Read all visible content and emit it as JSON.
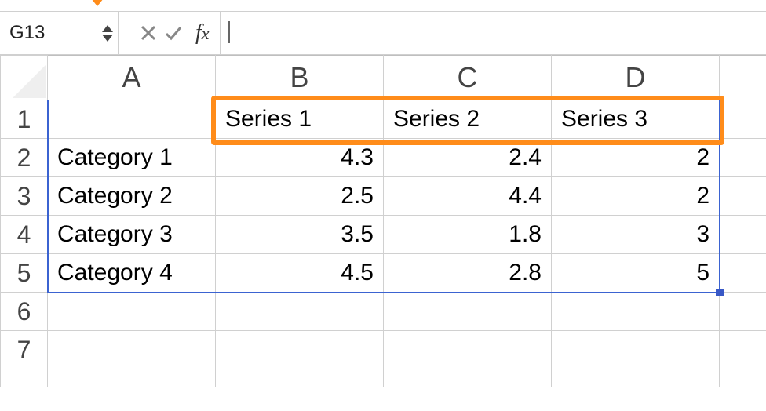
{
  "nameBox": {
    "value": "G13"
  },
  "formulaBar": {
    "cancel_icon": "x-icon",
    "accept_icon": "check-icon",
    "fx_f": "f",
    "fx_x": "x",
    "value": ""
  },
  "columns": {
    "A": "A",
    "B": "B",
    "C": "C",
    "D": "D"
  },
  "rows": {
    "1": "1",
    "2": "2",
    "3": "3",
    "4": "4",
    "5": "5",
    "6": "6",
    "7": "7"
  },
  "cells": {
    "B1": "Series 1",
    "C1": "Series 2",
    "D1": "Series 3",
    "A2": "Category 1",
    "B2": "4.3",
    "C2": "2.4",
    "D2": "2",
    "A3": "Category 2",
    "B3": "2.5",
    "C3": "4.4",
    "D3": "2",
    "A4": "Category 3",
    "B4": "3.5",
    "C4": "1.8",
    "D4": "3",
    "A5": "Category 4",
    "B5": "4.5",
    "C5": "2.8",
    "D5": "5"
  },
  "chart_data": {
    "type": "table",
    "categories": [
      "Category 1",
      "Category 2",
      "Category 3",
      "Category 4"
    ],
    "series": [
      {
        "name": "Series 1",
        "values": [
          4.3,
          2.5,
          3.5,
          4.5
        ]
      },
      {
        "name": "Series 2",
        "values": [
          2.4,
          4.4,
          1.8,
          2.8
        ]
      },
      {
        "name": "Series 3",
        "values": [
          2,
          2,
          3,
          5
        ]
      }
    ]
  },
  "colors": {
    "accent": "#ff8c1a",
    "selection": "#3b63d1",
    "gridline": "#d0d0d0"
  }
}
